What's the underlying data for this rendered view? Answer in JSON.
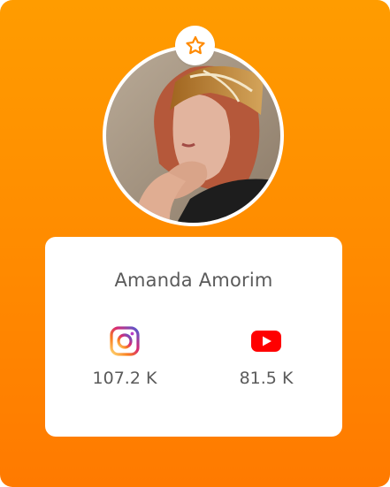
{
  "profile": {
    "name": "Amanda Amorim",
    "badge_icon": "star-icon",
    "accent_color": "#ff8a00"
  },
  "stats": {
    "instagram": {
      "icon": "instagram-icon",
      "count": "107.2 K"
    },
    "youtube": {
      "icon": "youtube-icon",
      "count": "81.5 K"
    }
  }
}
